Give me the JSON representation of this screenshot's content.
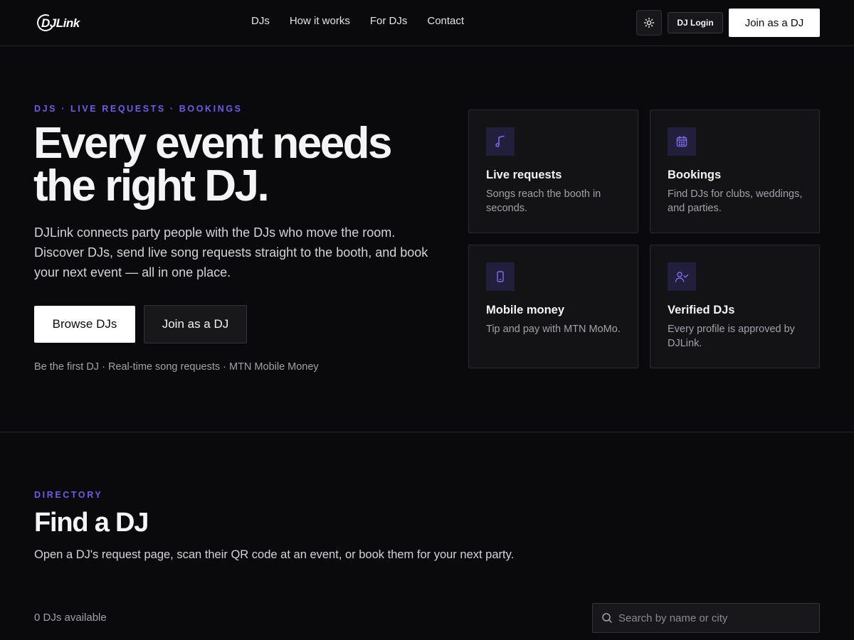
{
  "header": {
    "logo_text": "DJLink",
    "nav": [
      "DJs",
      "How it works",
      "For DJs",
      "Contact"
    ],
    "login_label": "DJ Login",
    "join_label": "Join as a DJ"
  },
  "hero": {
    "eyebrow": "DJS · LIVE REQUESTS · BOOKINGS",
    "title": "Every event needs the right DJ.",
    "description": "DJLink connects party people with the DJs who move the room. Discover DJs, send live song requests straight to the booth, and book your next event — all in one place.",
    "browse_label": "Browse DJs",
    "join_label": "Join as a DJ",
    "meta": "Be the first DJ · Real-time song requests · MTN Mobile Money"
  },
  "features": [
    {
      "icon": "music-note-icon",
      "title": "Live requests",
      "description": "Songs reach the booth in seconds."
    },
    {
      "icon": "calendar-icon",
      "title": "Bookings",
      "description": "Find DJs for clubs, weddings, and parties."
    },
    {
      "icon": "phone-icon",
      "title": "Mobile money",
      "description": "Tip and pay with MTN MoMo."
    },
    {
      "icon": "user-check-icon",
      "title": "Verified DJs",
      "description": "Every profile is approved by DJLink."
    }
  ],
  "directory": {
    "eyebrow": "DIRECTORY",
    "title": "Find a DJ",
    "description": "Open a DJ's request page, scan their QR code at an event, or book them for your next party.",
    "count": "0 DJs available",
    "search_placeholder": "Search by name or city"
  },
  "colors": {
    "background": "#0a0a0c",
    "accent": "#6d5ce8",
    "card": "#131316"
  }
}
